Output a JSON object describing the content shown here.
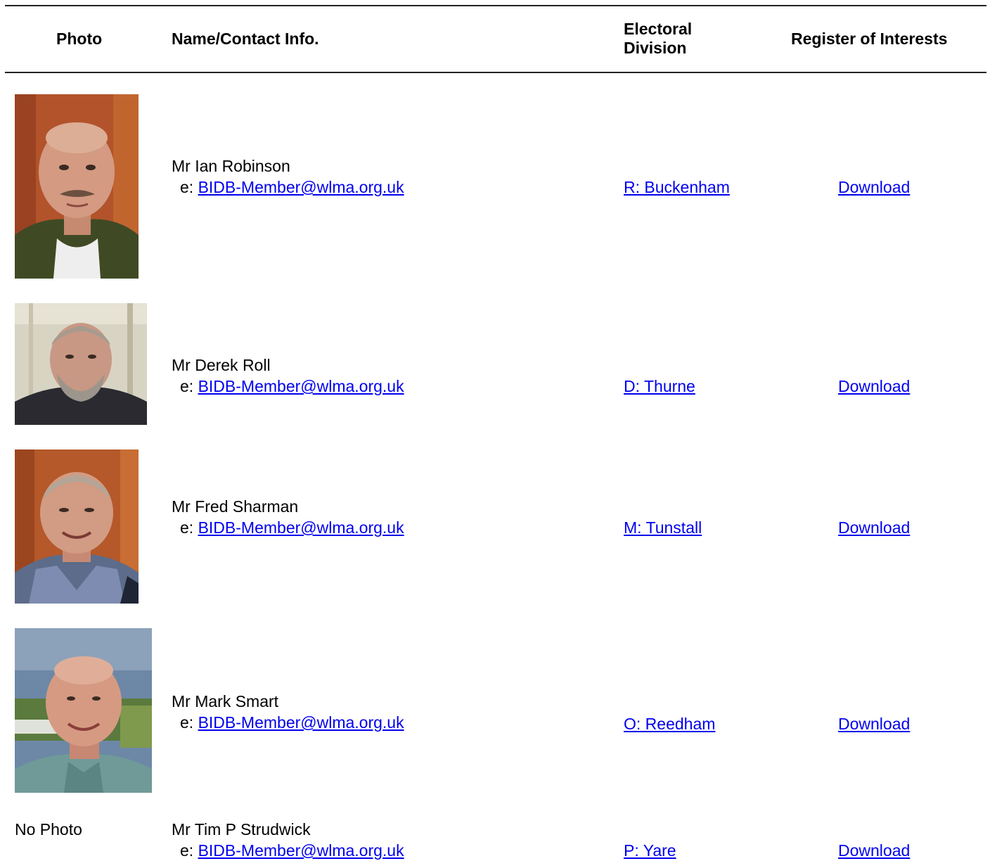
{
  "header": {
    "photo": "Photo",
    "name": "Name/Contact Info.",
    "division_line1": "Electoral",
    "division_line2": "Division",
    "register": "Register of Interests"
  },
  "members": [
    {
      "name": "Mr Ian Robinson",
      "email_prefix": "e: ",
      "email": "BIDB-Member@wlma.org.uk",
      "division": "R: Buckenham",
      "register_link": "Download",
      "has_photo": true
    },
    {
      "name": "Mr Derek Roll",
      "email_prefix": "e: ",
      "email": "BIDB-Member@wlma.org.uk",
      "division": "D: Thurne",
      "register_link": "Download",
      "has_photo": true
    },
    {
      "name": "Mr Fred Sharman",
      "email_prefix": "e: ",
      "email": "BIDB-Member@wlma.org.uk",
      "division": "M: Tunstall",
      "register_link": "Download",
      "has_photo": true
    },
    {
      "name": "Mr Mark Smart",
      "email_prefix": "e: ",
      "email": "BIDB-Member@wlma.org.uk",
      "division": "O: Reedham",
      "register_link": "Download",
      "has_photo": true
    },
    {
      "name": "Mr Tim P Strudwick",
      "email_prefix": "e: ",
      "email": "BIDB-Member@wlma.org.uk",
      "division": "P: Yare",
      "register_link": "Download",
      "has_photo": false,
      "no_photo_label": "No Photo"
    }
  ],
  "colors": {
    "link": "#0000ee",
    "rule": "#222222"
  }
}
